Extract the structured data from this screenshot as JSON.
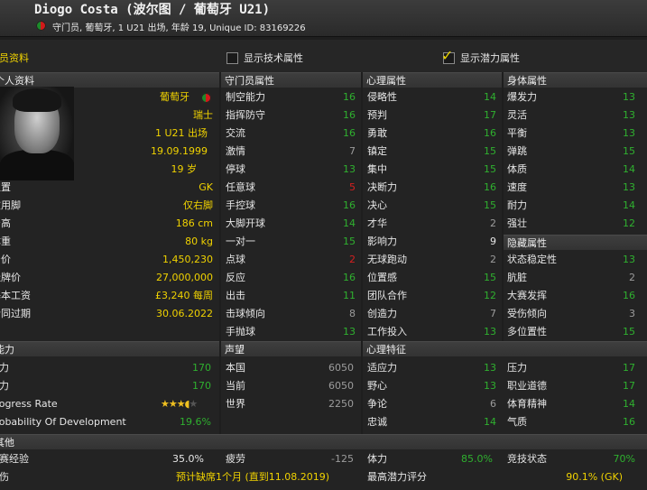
{
  "header": {
    "title": "Diogo Costa (波尔图 / 葡萄牙 U21)",
    "subtitle": "守门员, 葡萄牙, 1 U21 出场, 年龄 19, Unique ID: 83169226"
  },
  "toolbar": {
    "section": "球员资料",
    "show_tech": "显示技术属性",
    "show_potential": "显示潜力属性",
    "show_tech_checked": false,
    "show_potential_checked": true
  },
  "personal": {
    "header": "个人资料",
    "nation": "葡萄牙",
    "second": "瑞士",
    "caps": "1 U21 出场",
    "dob": "19.09.1999",
    "age": "19 岁",
    "rows": [
      {
        "label": "位置",
        "value": "GK"
      },
      {
        "label": "惯用脚",
        "value": "仅右脚"
      },
      {
        "label": "身高",
        "value": "186 cm"
      },
      {
        "label": "体重",
        "value": "80 kg"
      },
      {
        "label": "身价",
        "value": "1,450,230"
      },
      {
        "label": "挂牌价",
        "value": "27,000,000"
      },
      {
        "label": "基本工资",
        "value": "£3,240 每周"
      },
      {
        "label": "合同过期",
        "value": "30.06.2022"
      }
    ]
  },
  "gk_attrs": {
    "header": "守门员属性",
    "rows": [
      {
        "label": "制空能力",
        "value": "16",
        "c": "g"
      },
      {
        "label": "指挥防守",
        "value": "16",
        "c": "g"
      },
      {
        "label": "交流",
        "value": "16",
        "c": "g"
      },
      {
        "label": "激情",
        "value": "7",
        "c": "gr"
      },
      {
        "label": "停球",
        "value": "13",
        "c": "g"
      },
      {
        "label": "任意球",
        "value": "5",
        "c": "r"
      },
      {
        "label": "手控球",
        "value": "16",
        "c": "g"
      },
      {
        "label": "大脚开球",
        "value": "14",
        "c": "g"
      },
      {
        "label": "一对一",
        "value": "15",
        "c": "g"
      },
      {
        "label": "点球",
        "value": "2",
        "c": "r"
      },
      {
        "label": "反应",
        "value": "16",
        "c": "g"
      },
      {
        "label": "出击",
        "value": "11",
        "c": "g"
      },
      {
        "label": "击球倾向",
        "value": "8",
        "c": "gr"
      },
      {
        "label": "手抛球",
        "value": "13",
        "c": "g"
      }
    ]
  },
  "mental": {
    "header": "心理属性",
    "rows": [
      {
        "label": "侵略性",
        "value": "14",
        "c": "g"
      },
      {
        "label": "预判",
        "value": "17",
        "c": "g"
      },
      {
        "label": "勇敢",
        "value": "16",
        "c": "g"
      },
      {
        "label": "镇定",
        "value": "15",
        "c": "g"
      },
      {
        "label": "集中",
        "value": "15",
        "c": "g"
      },
      {
        "label": "决断力",
        "value": "16",
        "c": "g"
      },
      {
        "label": "决心",
        "value": "15",
        "c": "g"
      },
      {
        "label": "才华",
        "value": "2",
        "c": "gr"
      },
      {
        "label": "影响力",
        "value": "9",
        "c": "w"
      },
      {
        "label": "无球跑动",
        "value": "2",
        "c": "gr"
      },
      {
        "label": "位置感",
        "value": "15",
        "c": "g"
      },
      {
        "label": "团队合作",
        "value": "12",
        "c": "g"
      },
      {
        "label": "创造力",
        "value": "7",
        "c": "gr"
      },
      {
        "label": "工作投入",
        "value": "13",
        "c": "g"
      }
    ]
  },
  "physical": {
    "header": "身体属性",
    "rows": [
      {
        "label": "爆发力",
        "value": "13",
        "c": "g"
      },
      {
        "label": "灵活",
        "value": "13",
        "c": "g"
      },
      {
        "label": "平衡",
        "value": "13",
        "c": "g"
      },
      {
        "label": "弹跳",
        "value": "15",
        "c": "g"
      },
      {
        "label": "体质",
        "value": "14",
        "c": "g"
      },
      {
        "label": "速度",
        "value": "13",
        "c": "g"
      },
      {
        "label": "耐力",
        "value": "14",
        "c": "g"
      },
      {
        "label": "强壮",
        "value": "12",
        "c": "g"
      }
    ]
  },
  "hidden": {
    "header": "隐藏属性",
    "rows": [
      {
        "label": "状态稳定性",
        "value": "13",
        "c": "g"
      },
      {
        "label": "肮脏",
        "value": "2",
        "c": "gr"
      },
      {
        "label": "大赛发挥",
        "value": "16",
        "c": "g"
      },
      {
        "label": "受伤倾向",
        "value": "3",
        "c": "gr"
      },
      {
        "label": "多位置性",
        "value": "15",
        "c": "g"
      }
    ]
  },
  "ability": {
    "header": "能力",
    "rows": [
      {
        "label": "能力",
        "value": "170"
      },
      {
        "label": "潜力",
        "value": "170"
      },
      {
        "label": "Progress Rate",
        "value": "",
        "stars": "★★★",
        "half": "◖",
        "empty": "★"
      },
      {
        "label": "Probability Of Development",
        "value": "19.6%"
      }
    ]
  },
  "reputation": {
    "header": "声望",
    "rows": [
      {
        "label": "本国",
        "value": "6050"
      },
      {
        "label": "当前",
        "value": "6050"
      },
      {
        "label": "世界",
        "value": "2250"
      }
    ]
  },
  "personality": {
    "header": "心理特征",
    "rows": [
      {
        "label": "适应力",
        "value": "13",
        "c": "g"
      },
      {
        "label": "压力",
        "value": "17",
        "c": "g"
      },
      {
        "label": "野心",
        "value": "13",
        "c": "g"
      },
      {
        "label": "职业道德",
        "value": "17",
        "c": "g"
      },
      {
        "label": "争论",
        "value": "6",
        "c": "gr"
      },
      {
        "label": "体育精神",
        "value": "14",
        "c": "g"
      },
      {
        "label": "忠诚",
        "value": "14",
        "c": "g"
      },
      {
        "label": "气质",
        "value": "16",
        "c": "g"
      }
    ]
  },
  "other": {
    "header": "其他",
    "match_exp_label": "比赛经验",
    "match_exp": "35.0%",
    "fatigue_label": "疲劳",
    "fatigue": "-125",
    "stamina_label": "体力",
    "stamina": "85.0%",
    "form_label": "竞技状态",
    "form": "70%",
    "injury_label": "受伤",
    "injury": "预计缺席1个月 (直到11.08.2019)",
    "best_pot_label": "最高潜力评分",
    "best_pot": "90.1% (GK)"
  }
}
